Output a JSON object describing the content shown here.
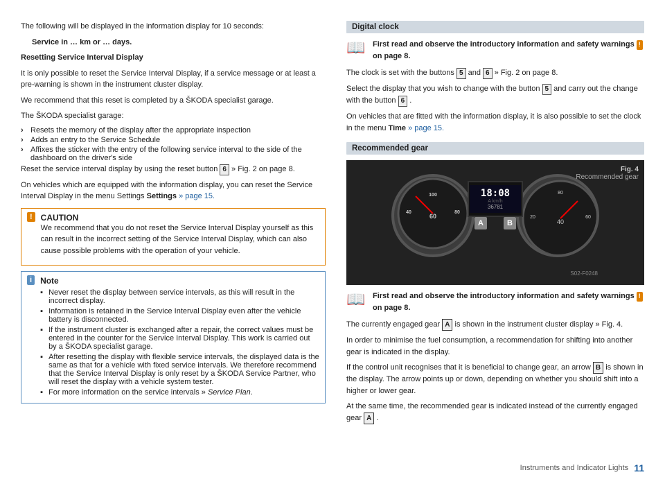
{
  "page": {
    "number": "11",
    "footer_text": "Instruments and Indicator Lights"
  },
  "left_col": {
    "intro": "The following will be displayed in the information display for 10 seconds:",
    "service_line": "Service in … km or … days.",
    "resetting_title": "Resetting Service Interval Display",
    "resetting_p1": "It is only possible to reset the Service Interval Display, if a service message or at least a pre-warning is shown in the instrument cluster display.",
    "resetting_p2": "We recommend that this reset is completed by a ŠKODA specialist garage.",
    "specialist_intro": "The ŠKODA specialist garage:",
    "arrow_items": [
      "Resets the memory of the display after the appropriate inspection",
      "Adds an entry to the Service Schedule",
      "Affixes the sticker with the entry of the following service interval to the side of the dashboard on the driver's side"
    ],
    "reset_p": "Reset the service interval display by using the reset button",
    "reset_btn": "6",
    "reset_suffix": " » Fig. 2 on page 8.",
    "vehicles_settings_p": "On vehicles which are equipped with the information display, you can reset the Service Interval Display in the menu Settings",
    "settings_link": " » page 15.",
    "caution": {
      "title": "CAUTION",
      "icon": "!",
      "text": "We recommend that you do not reset the Service Interval Display yourself as this can result in the incorrect setting of the Service Interval Display, which can also cause possible problems with the operation of your vehicle."
    },
    "note": {
      "title": "Note",
      "icon": "i",
      "items": [
        "Never reset the display between service intervals, as this will result in the incorrect display.",
        "Information is retained in the Service Interval Display even after the vehicle battery is disconnected.",
        "If the instrument cluster is exchanged after a repair, the correct values must be entered in the counter for the Service Interval Display. This work is carried out by a ŠKODA specialist garage.",
        "After resetting the display with flexible service intervals, the displayed data is the same as that for a vehicle with fixed service intervals. We therefore recommend that the Service Interval Display is only reset by a ŠKODA Service Partner, who will reset the display with a vehicle system tester.",
        "For more information on the service intervals » Service Plan."
      ]
    }
  },
  "right_col": {
    "digital_clock": {
      "section_title": "Digital clock",
      "warning_text": "First read and observe the introductory information and safety warnings",
      "warning_icon": "!",
      "warning_suffix": " on page 8.",
      "p1_prefix": "The clock is set with the buttons",
      "p1_btn1": "5",
      "p1_mid": " and",
      "p1_btn2": "6",
      "p1_suffix": " » Fig. 2 on page 8.",
      "p2_prefix": "Select the display that you wish to change with the button",
      "p2_btn": "5",
      "p2_suffix": " and carry out the change with the button",
      "p2_btn2": "6",
      "p3": "On vehicles that are fitted with the information display, it is also possible to set the clock in the menu",
      "p3_menu": " Time",
      "p3_link": " » page 15."
    },
    "recommended_gear": {
      "section_title": "Recommended gear",
      "fig_label": "Fig. 4",
      "fig_sublabel": "Recommended gear",
      "fig_img_id": "S02-F0248",
      "warning_text": "First read and observe the introductory information and safety warnings",
      "warning_icon": "!",
      "warning_suffix": " on page 8.",
      "p1_prefix": "The currently engaged gear",
      "p1_box": "A",
      "p1_suffix": " is shown in the instrument cluster display » Fig. 4.",
      "p2": "In order to minimise the fuel consumption, a recommendation for shifting into another gear is indicated in the display.",
      "p3_prefix": "If the control unit recognises that it is beneficial to change gear, an arrow",
      "p3_box": "B",
      "p3_suffix": " is shown in the display. The arrow points up or down, depending on whether you should shift into a higher or lower gear.",
      "p4_prefix": "At the same time, the recommended gear is indicated instead of the currently engaged gear",
      "p4_box": "A",
      "p4_suffix": "."
    }
  }
}
